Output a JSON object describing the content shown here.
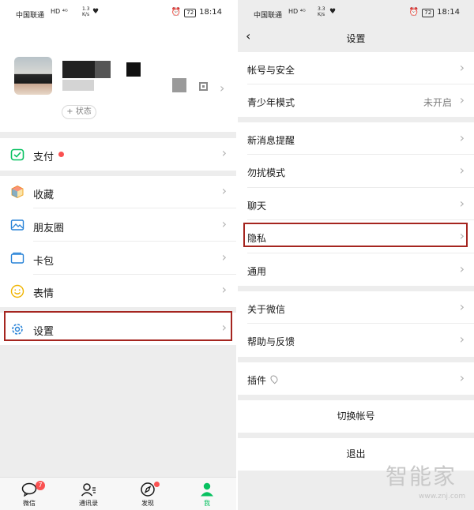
{
  "status_bar": {
    "carrier": "中国联通",
    "net_left": "1.3",
    "net_unit": "K/s",
    "net_right": "3.3",
    "battery": "72",
    "time": "18:14"
  },
  "me_page": {
    "status_button": "+ 状态",
    "menu": [
      {
        "label": "支付",
        "icon": "wechat-pay-icon",
        "has_dot": true
      },
      {
        "label": "收藏",
        "icon": "favorites-cube-icon"
      },
      {
        "label": "朋友圈",
        "icon": "moments-photo-icon"
      },
      {
        "label": "卡包",
        "icon": "card-wallet-icon"
      },
      {
        "label": "表情",
        "icon": "sticker-smile-icon"
      },
      {
        "label": "设置",
        "icon": "settings-gear-icon",
        "highlighted": true
      }
    ],
    "tabbar": [
      {
        "label": "微信",
        "icon": "chat-icon",
        "badge": "7"
      },
      {
        "label": "通讯录",
        "icon": "contacts-icon"
      },
      {
        "label": "发现",
        "icon": "discover-compass-icon",
        "dot": true
      },
      {
        "label": "我",
        "icon": "me-person-icon",
        "active": true
      }
    ]
  },
  "settings_page": {
    "title": "设置",
    "groups": [
      [
        {
          "label": "帐号与安全"
        },
        {
          "label": "青少年模式",
          "value": "未开启"
        }
      ],
      [
        {
          "label": "新消息提醒"
        },
        {
          "label": "勿扰模式"
        },
        {
          "label": "聊天"
        },
        {
          "label": "隐私",
          "highlighted": true
        },
        {
          "label": "通用"
        }
      ],
      [
        {
          "label": "关于微信"
        },
        {
          "label": "帮助与反馈"
        }
      ],
      [
        {
          "label": "插件"
        }
      ]
    ],
    "switch_account": "切换帐号",
    "logout": "退出"
  },
  "watermark": {
    "text": "智能家",
    "url": "www.znj.com"
  },
  "colors": {
    "accent_green": "#07c160",
    "highlight_red": "#a5251f",
    "badge_red": "#fa5151"
  }
}
